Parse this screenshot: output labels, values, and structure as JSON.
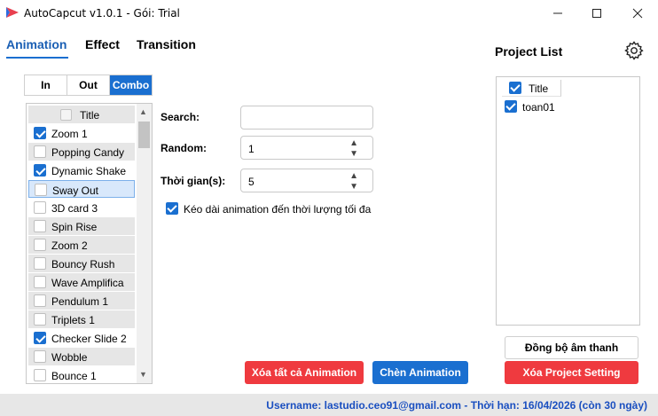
{
  "window": {
    "title": "AutoCapcut v1.0.1 - Gói: Trial",
    "minimize_glyph": "—",
    "maximize_glyph": "☐",
    "close_glyph": "✕"
  },
  "main_tabs": [
    {
      "label": "Animation",
      "active": true
    },
    {
      "label": "Effect",
      "active": false
    },
    {
      "label": "Transition",
      "active": false
    }
  ],
  "sub_tabs": [
    {
      "label": "In",
      "active": false
    },
    {
      "label": "Out",
      "active": false
    },
    {
      "label": "Combo",
      "active": true
    }
  ],
  "animation_list": {
    "header": "Title",
    "items": [
      {
        "label": "Zoom 1",
        "checked": true
      },
      {
        "label": "Popping Candy",
        "checked": false
      },
      {
        "label": "Dynamic Shake",
        "checked": true
      },
      {
        "label": "Sway Out",
        "checked": false
      },
      {
        "label": "3D card 3",
        "checked": false
      },
      {
        "label": "Spin Rise",
        "checked": false
      },
      {
        "label": "Zoom 2",
        "checked": false
      },
      {
        "label": "Bouncy Rush",
        "checked": false
      },
      {
        "label": "Wave Amplifica",
        "checked": false
      },
      {
        "label": "Pendulum 1",
        "checked": false
      },
      {
        "label": "Triplets 1",
        "checked": false
      },
      {
        "label": "Checker Slide 2",
        "checked": true
      },
      {
        "label": "Wobble",
        "checked": false
      },
      {
        "label": "Bounce 1",
        "checked": false
      }
    ]
  },
  "form": {
    "search_label": "Search:",
    "search_value": "",
    "random_label": "Random:",
    "random_value": "1",
    "duration_label": "Thời gian(s):",
    "duration_value": "5",
    "extend_label": "Kéo dài animation đến thời lượng tối đa",
    "extend_checked": true
  },
  "project": {
    "title": "Project List",
    "header": "Title",
    "items": [
      {
        "label": "toan01",
        "checked": true
      }
    ]
  },
  "buttons": {
    "clear_animation": "Xóa tất cả Animation",
    "insert_animation": "Chèn Animation",
    "sync_audio": "Đồng bộ âm thanh",
    "clear_project_setting": "Xóa Project Setting"
  },
  "status": {
    "text": "Username: lastudio.ceo91@gmail.com - Thời hạn: 16/04/2026 (còn 30 ngày)"
  },
  "colors": {
    "accent": "#1a6fd0",
    "danger": "#ef3a3f",
    "status_text": "#1a4fc0"
  }
}
